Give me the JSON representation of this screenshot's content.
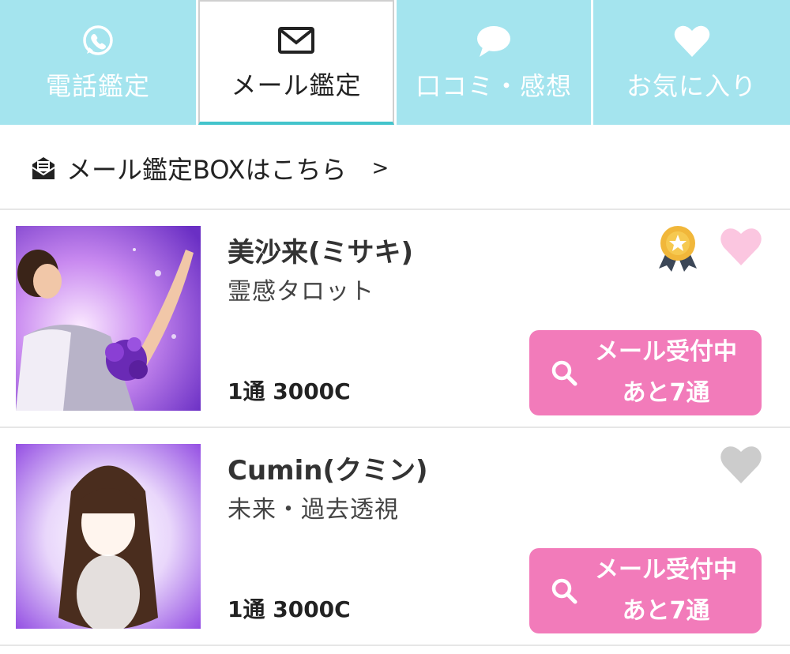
{
  "tabs": [
    {
      "label": "電話鑑定",
      "icon": "whatsapp-phone-icon",
      "active": false
    },
    {
      "label": "メール鑑定",
      "icon": "envelope-icon",
      "active": true
    },
    {
      "label": "口コミ・感想",
      "icon": "speech-bubble-icon",
      "active": false
    },
    {
      "label": "お気に入り",
      "icon": "heart-icon",
      "active": false
    }
  ],
  "mailbox": {
    "label": "メール鑑定BOXはこちら",
    "arrow": ">",
    "icon": "mail-inbox-icon"
  },
  "fortune_tellers": [
    {
      "name": "美沙来(ミサキ)",
      "genre": "霊感タロット",
      "price": "1通 3000C",
      "has_award_badge": true,
      "favorite": true,
      "button_line1": "メール受付中",
      "button_line2": "あと7通"
    },
    {
      "name": "Cumin(クミン)",
      "genre": "未来・過去透視",
      "price": "1通 3000C",
      "has_award_badge": false,
      "favorite": false,
      "button_line1": "メール受付中",
      "button_line2": "あと7通"
    }
  ],
  "colors": {
    "tab_bg": "#a4e4ee",
    "active_underline": "#43c4cc",
    "button_pink": "#f27bba",
    "heart_pink": "#fbc6e0",
    "heart_gray": "#cccccc"
  }
}
